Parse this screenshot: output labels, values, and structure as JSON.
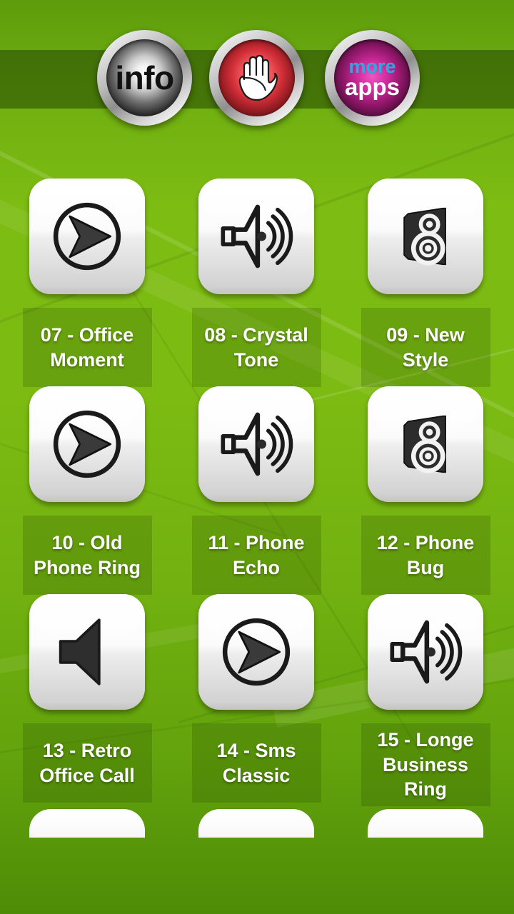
{
  "header": {
    "info_button": {
      "label": "info",
      "icon": "info-text"
    },
    "stop_button": {
      "label": "",
      "icon": "hand-stop-icon"
    },
    "more_button": {
      "label_top": "more",
      "label_bottom": "apps",
      "icon": "more-apps-text"
    },
    "band_color": "#1d3b00"
  },
  "theme": {
    "background_green": "#7cbb12",
    "label_tile": "#4f7a08",
    "accent_cyan": "#29abe2",
    "accent_magenta": "#d62ea2",
    "accent_red": "#cf2d36",
    "text_white": "#ffffff"
  },
  "grid": {
    "columns": 3,
    "items": [
      {
        "number": "07",
        "title": "Office Moment",
        "label": "07 - Office Moment",
        "icon": "play-arrow-circle-icon"
      },
      {
        "number": "08",
        "title": "Crystal Tone",
        "label": "08 - Crystal Tone",
        "icon": "megaphone-waves-icon"
      },
      {
        "number": "09",
        "title": "New Style",
        "label": "09 - New Style",
        "icon": "loudspeaker-cabinet-icon"
      },
      {
        "number": "10",
        "title": "Old Phone Ring",
        "label": "10 - Old Phone Ring",
        "icon": "play-arrow-circle-icon"
      },
      {
        "number": "11",
        "title": "Phone Echo",
        "label": "11 - Phone Echo",
        "icon": "megaphone-waves-icon"
      },
      {
        "number": "12",
        "title": "Phone Bug",
        "label": "12 - Phone Bug",
        "icon": "loudspeaker-cabinet-icon"
      },
      {
        "number": "13",
        "title": "Retro Office Call",
        "label": "13 - Retro Office Call",
        "icon": "volume-speaker-icon"
      },
      {
        "number": "14",
        "title": "Sms Classic",
        "label": "14 - Sms Classic",
        "icon": "play-arrow-circle-icon"
      },
      {
        "number": "15",
        "title": "Longe Business Ring",
        "label": "15 - Longe Business Ring",
        "icon": "megaphone-waves-icon"
      }
    ]
  }
}
